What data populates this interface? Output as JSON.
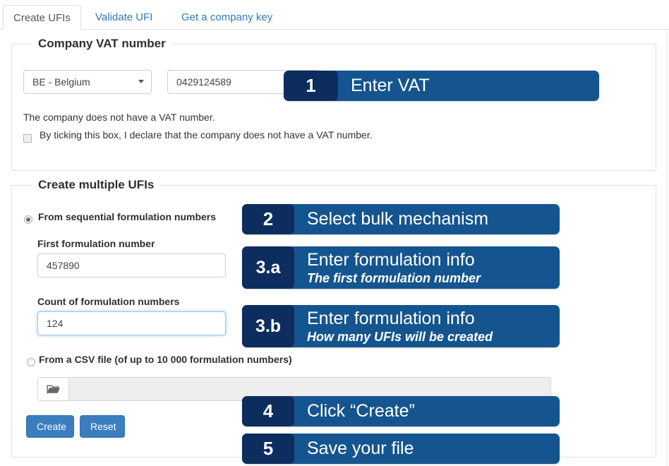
{
  "tabs": [
    {
      "label": "Create UFIs",
      "active": true
    },
    {
      "label": "Validate UFI",
      "active": false
    },
    {
      "label": "Get a company key",
      "active": false
    }
  ],
  "vat_section": {
    "legend": "Company VAT number",
    "country_select": {
      "value": "BE - Belgium",
      "caret_icon": "chevron-down-icon"
    },
    "vat_input": {
      "value": "0429124589",
      "placeholder": ""
    },
    "no_vat_text": "The company does not have a VAT number.",
    "no_vat_checkbox": {
      "label": "By ticking this box, I declare that the company does not have a VAT number.",
      "checked": false
    }
  },
  "bulk_section": {
    "legend": "Create multiple UFIs",
    "radio_sequential": {
      "label": "From sequential formulation numbers",
      "checked": true
    },
    "first_number": {
      "label": "First formulation number",
      "value": "457890",
      "focused": false
    },
    "count_numbers": {
      "label": "Count of formulation numbers",
      "value": "124",
      "focused": true
    },
    "radio_csv": {
      "label": "From a CSV file (of up to 10 000 formulation numbers)",
      "checked": false
    },
    "file_picker": {
      "browse_icon": "folder-open-icon",
      "file_name": ""
    },
    "buttons": {
      "create": "Create",
      "reset": "Reset"
    }
  },
  "callouts": [
    {
      "num": "1",
      "title": "Enter VAT",
      "sub": ""
    },
    {
      "num": "2",
      "title": "Select bulk mechanism",
      "sub": ""
    },
    {
      "num": "3.a",
      "title": "Enter formulation info",
      "sub": "The first formulation number"
    },
    {
      "num": "3.b",
      "title": "Enter formulation info",
      "sub": "How many UFIs will be created"
    },
    {
      "num": "4",
      "title": "Click “Create”",
      "sub": ""
    },
    {
      "num": "5",
      "title": "Save your file",
      "sub": ""
    }
  ],
  "colors": {
    "callout_body": "#15558f",
    "callout_number": "#0c2d5e",
    "button_primary": "#3b7dbd",
    "tab_link": "#337ab7"
  }
}
